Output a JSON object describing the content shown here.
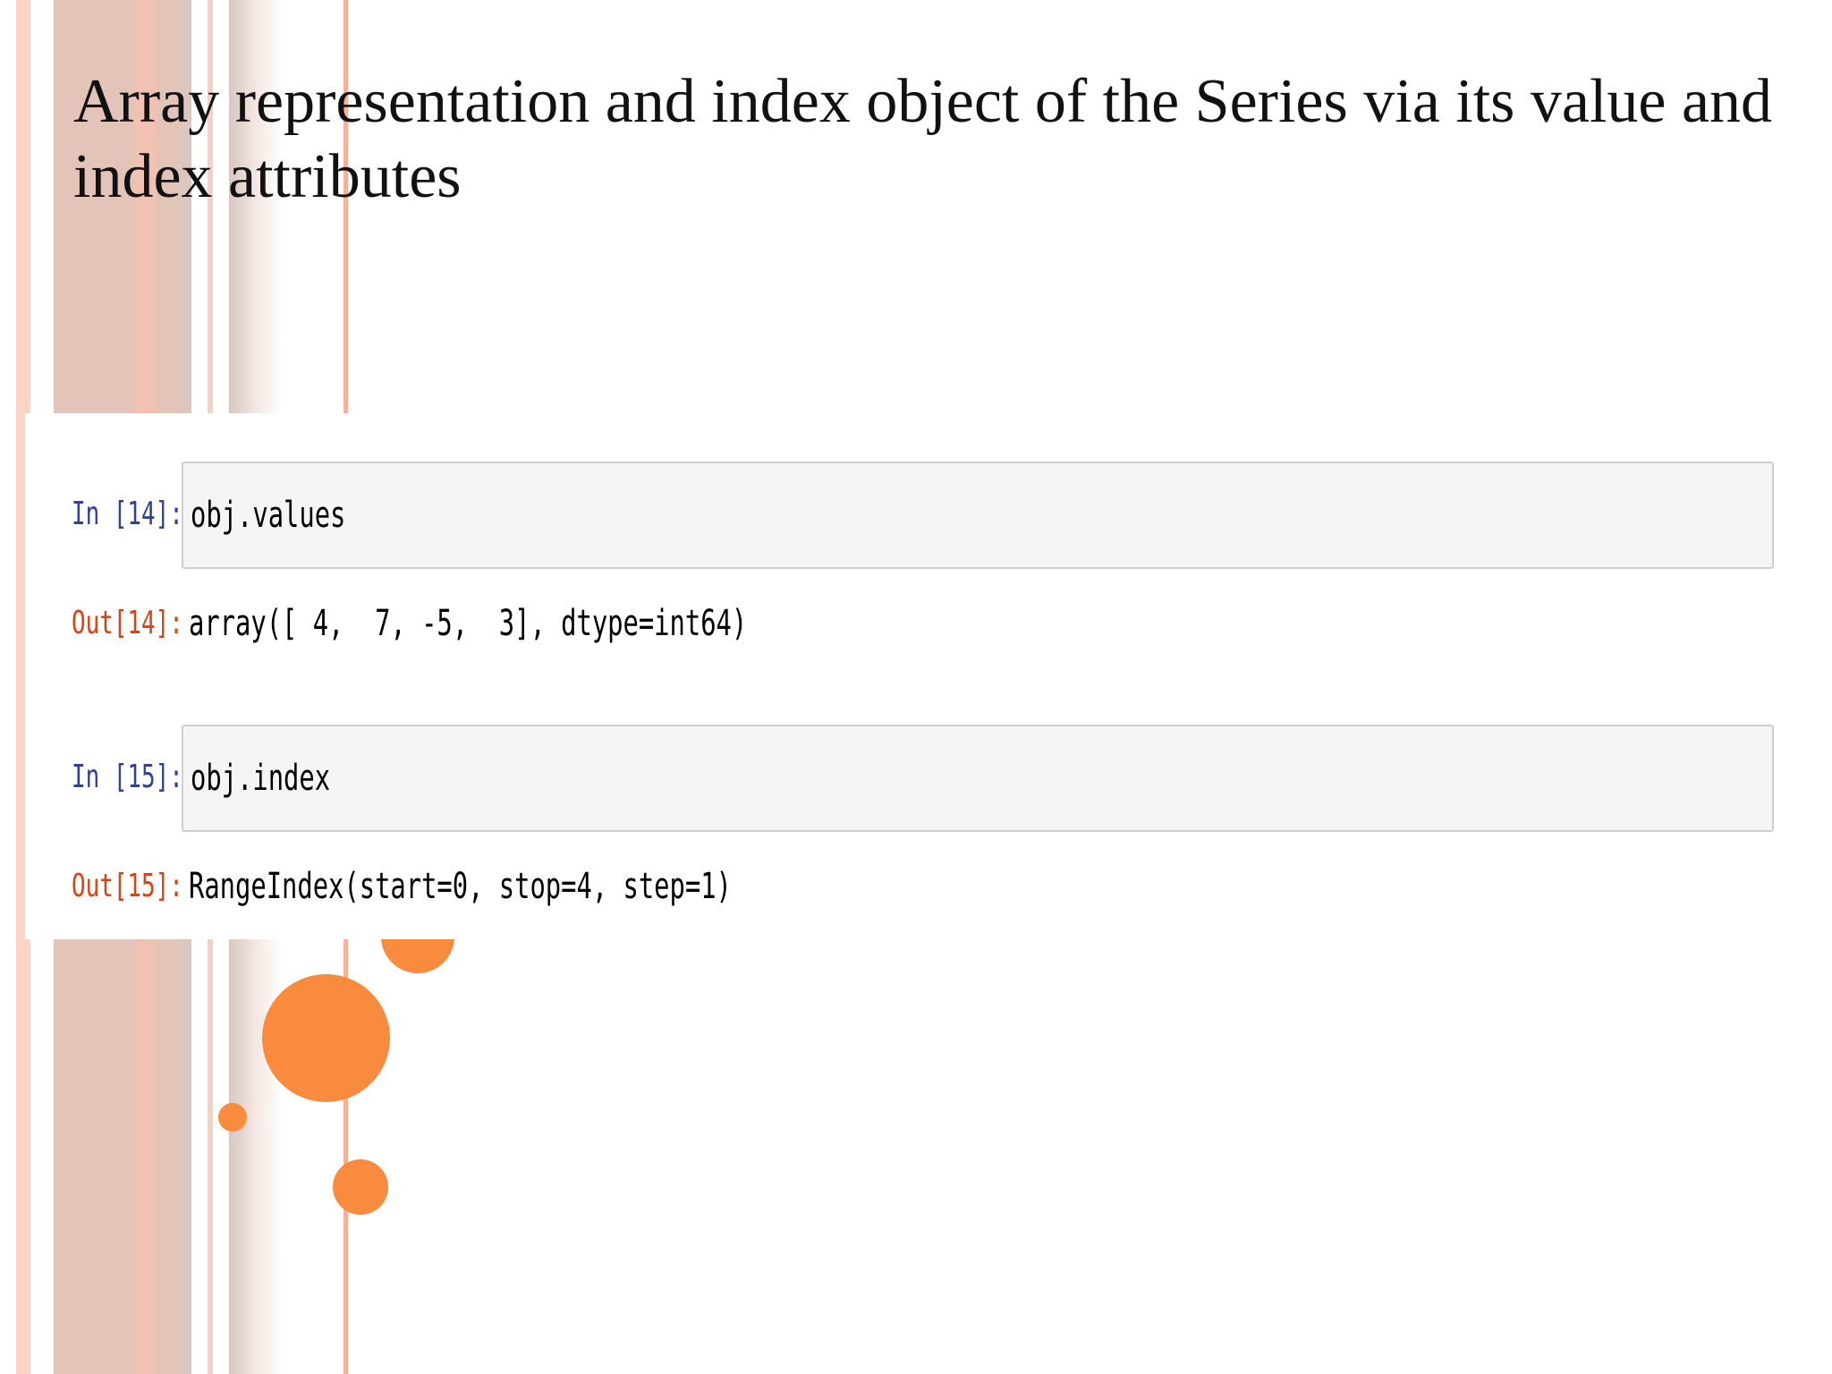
{
  "slide": {
    "title": "Array representation and index object of the Series via its value and index attributes"
  },
  "cells": [
    {
      "in_prompt": "In [14]:",
      "code": "obj.values",
      "out_prompt": "Out[14]:",
      "output": "array([ 4,  7, -5,  3], dtype=int64)"
    },
    {
      "in_prompt": "In [15]:",
      "code": "obj.index",
      "out_prompt": "Out[15]:",
      "output": "RangeIndex(start=0, stop=4, step=1)"
    }
  ],
  "colors": {
    "in_prompt": "#303f9f",
    "out_prompt": "#d84315",
    "accent_dot": "#f98b3e",
    "stripe": "#e2c4b9"
  }
}
